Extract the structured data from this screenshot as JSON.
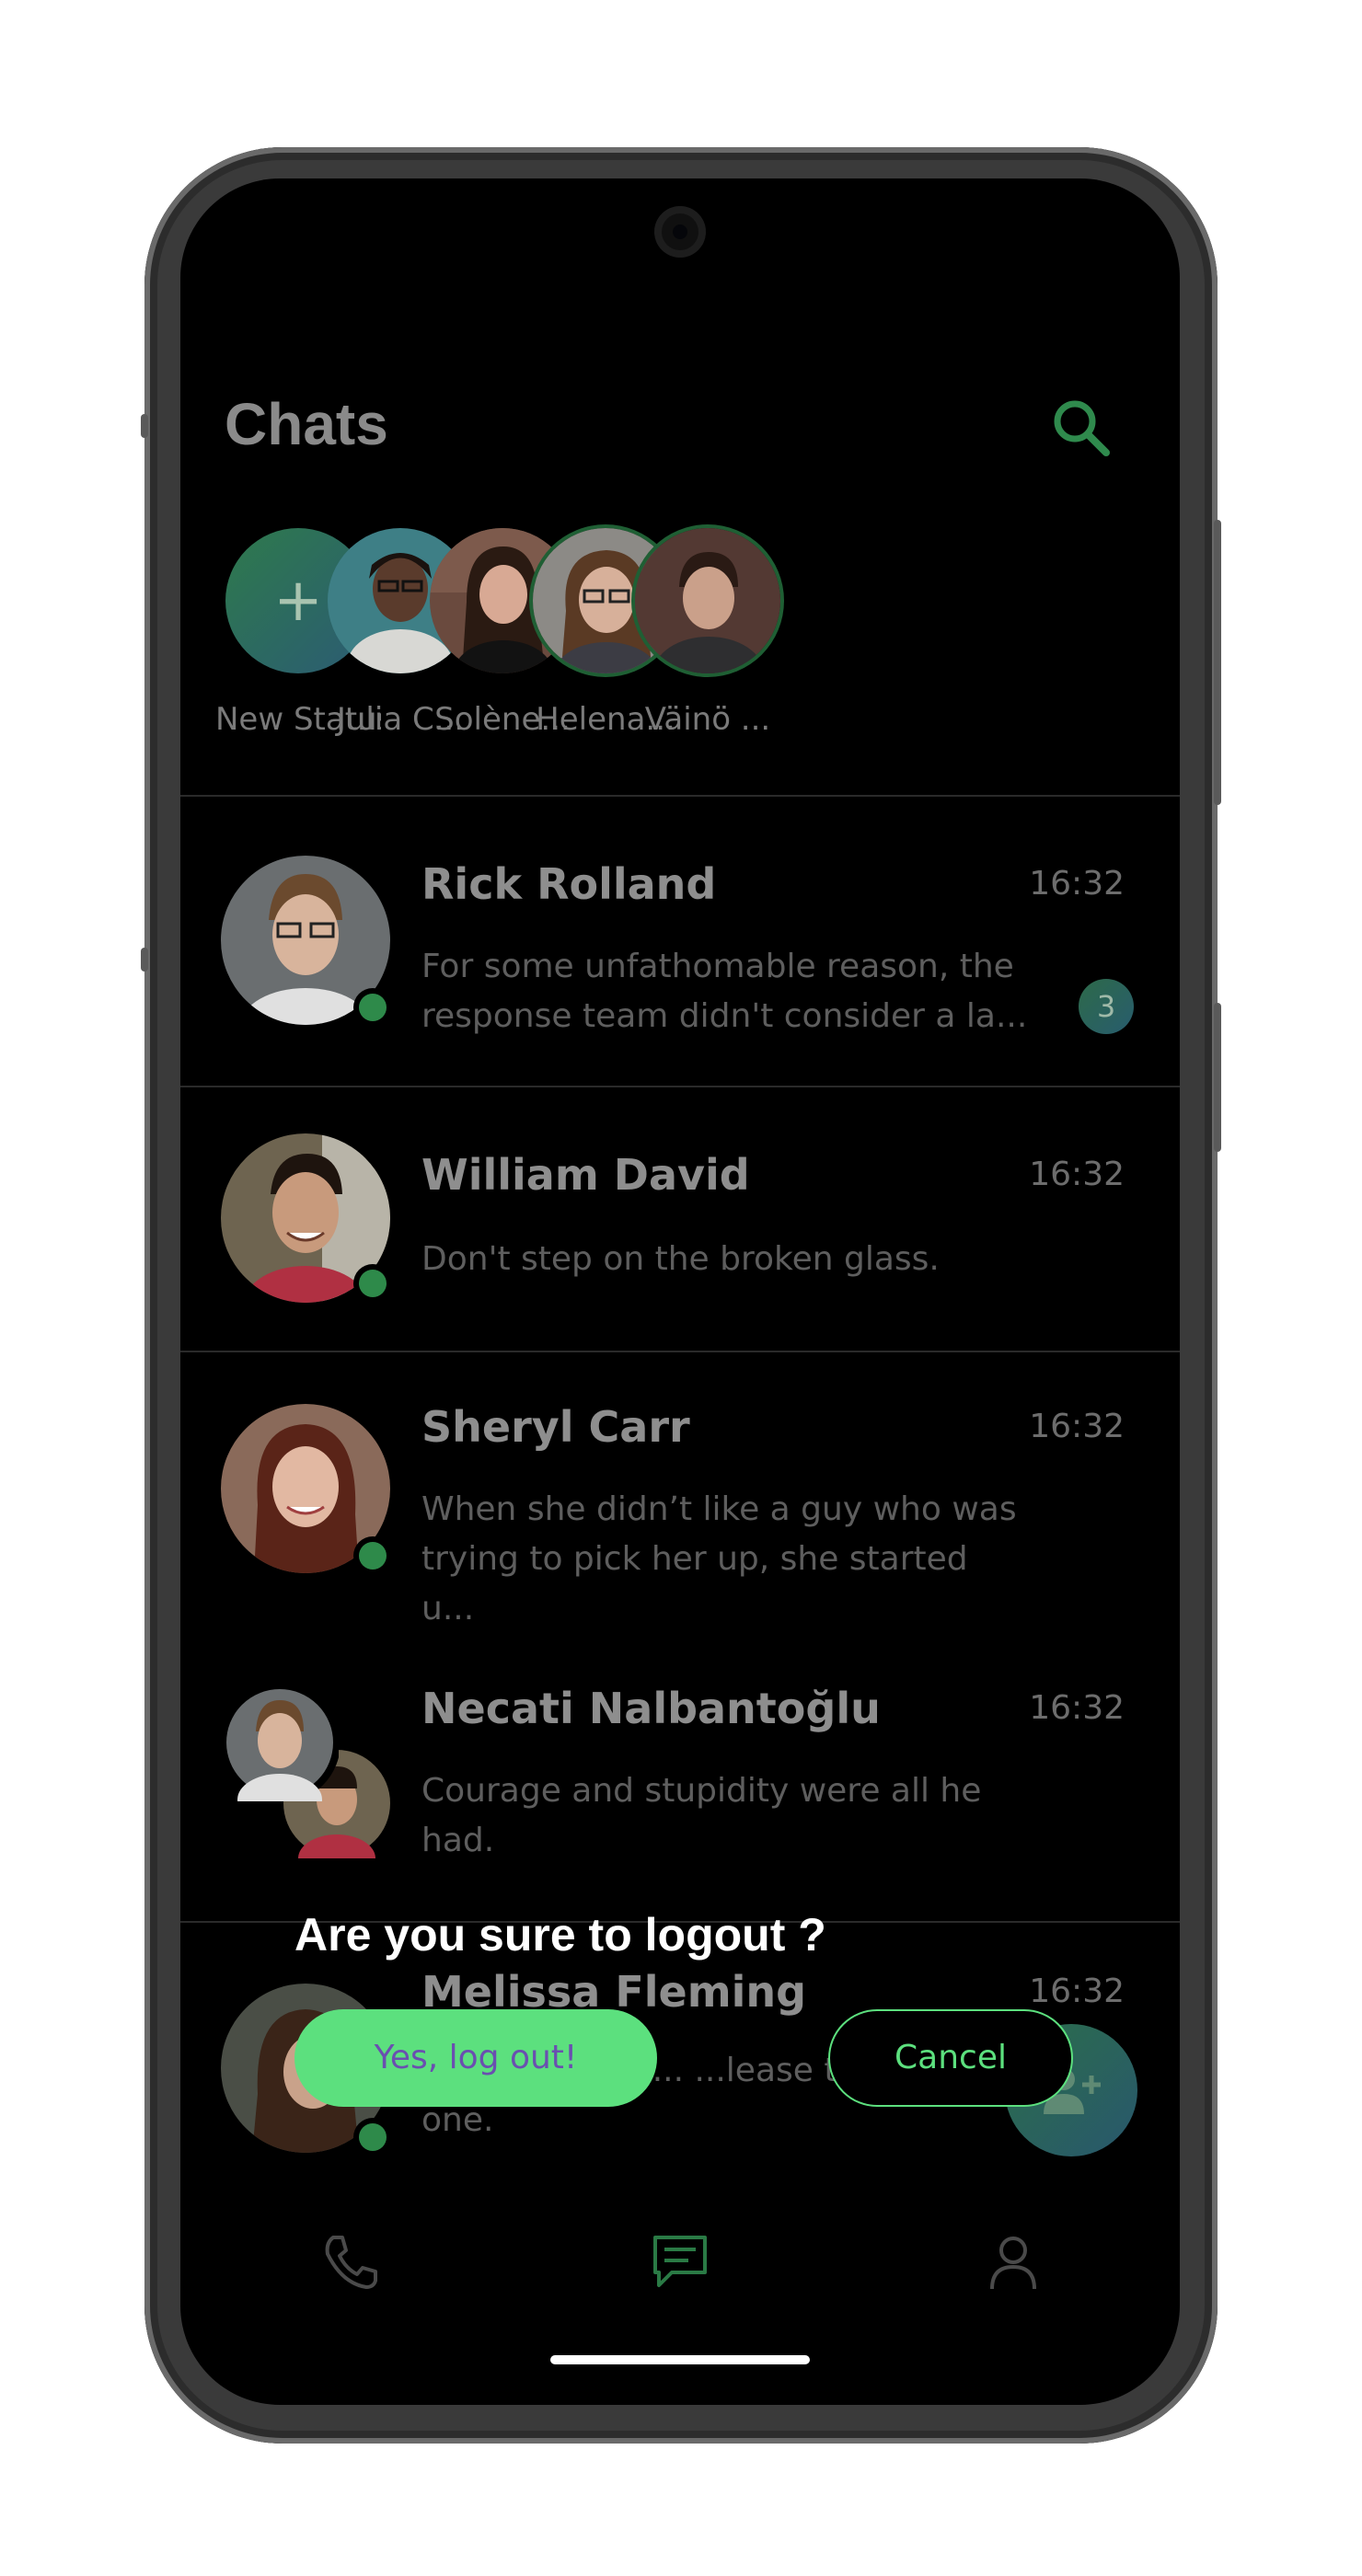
{
  "header": {
    "title": "Chats"
  },
  "statuses": [
    {
      "label": "New Status",
      "type": "new"
    },
    {
      "label": "Julia C...",
      "type": "contact"
    },
    {
      "label": "Solène...",
      "type": "contact"
    },
    {
      "label": "Helena...",
      "type": "contact",
      "unseen": true
    },
    {
      "label": "Väinö ...",
      "type": "contact",
      "unseen": true
    }
  ],
  "chats": [
    {
      "name": "Rick Rolland",
      "time": "16:32",
      "message": "For some unfathomable reason, the response team didn't consider a la...",
      "unread": "3",
      "online": true
    },
    {
      "name": "William David",
      "time": "16:32",
      "message": "Don't step on the broken glass.",
      "online": true
    },
    {
      "name": "Sheryl Carr",
      "time": "16:32",
      "message": "When she didn’t like a guy who was trying to pick her up, she started u...",
      "online": true
    },
    {
      "name": "Necati Nalbantoğlu",
      "time": "16:32",
      "message": "Courage and stupidity were all he had.",
      "group": true
    },
    {
      "name": "Melissa Fleming",
      "time": "16:32",
      "message": "...dy the red c... ...lease the blue one.",
      "online": true
    }
  ],
  "dialog": {
    "title": "Are you sure to logout ?",
    "confirm_label": "Yes, log out!",
    "cancel_label": "Cancel"
  },
  "bottom_nav": [
    {
      "icon": "phone-icon",
      "active": false
    },
    {
      "icon": "chat-icon",
      "active": true
    },
    {
      "icon": "profile-icon",
      "active": false
    }
  ],
  "colors": {
    "accent": "#5ce07e",
    "online": "#2e8a4a",
    "background": "#000000"
  }
}
